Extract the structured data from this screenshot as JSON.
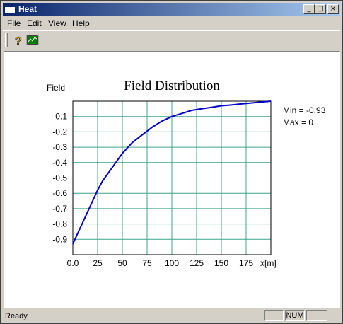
{
  "window": {
    "title": "Heat",
    "minimize_glyph": "_",
    "maximize_glyph": "□",
    "close_glyph": "×"
  },
  "menu": {
    "items": [
      "File",
      "Edit",
      "View",
      "Help"
    ]
  },
  "toolbar": {
    "buttons": [
      {
        "name": "help-icon",
        "glyph": "?"
      },
      {
        "name": "chart-icon"
      }
    ]
  },
  "chart_data": {
    "type": "line",
    "title": "Field Distribution",
    "ylabel": "Field",
    "xlabel": "x[m]",
    "x_ticks": [
      "0.0",
      "25",
      "50",
      "75",
      "100",
      "125",
      "150",
      "175"
    ],
    "y_ticks": [
      "-0.1",
      "-0.2",
      "-0.3",
      "-0.4",
      "-0.5",
      "-0.6",
      "-0.7",
      "-0.8",
      "-0.9"
    ],
    "xlim": [
      0,
      200
    ],
    "ylim": [
      -1.0,
      0
    ],
    "grid": true,
    "colors": {
      "line": "#0000c8",
      "grid": "#3fa48b"
    },
    "annotations": [
      "Min = -0.93",
      "Max = 0"
    ],
    "series": [
      {
        "x": [
          0,
          5,
          10,
          15,
          20,
          25,
          30,
          40,
          50,
          60,
          70,
          80,
          90,
          100,
          110,
          120,
          130,
          140,
          150,
          160,
          170,
          180,
          190,
          200
        ],
        "values": [
          -0.93,
          -0.86,
          -0.79,
          -0.72,
          -0.65,
          -0.58,
          -0.52,
          -0.43,
          -0.34,
          -0.27,
          -0.22,
          -0.17,
          -0.13,
          -0.1,
          -0.08,
          -0.06,
          -0.05,
          -0.04,
          -0.03,
          -0.025,
          -0.018,
          -0.012,
          -0.006,
          0.0
        ]
      }
    ]
  },
  "status": {
    "text": "Ready",
    "panes": [
      "",
      "NUM",
      ""
    ]
  }
}
